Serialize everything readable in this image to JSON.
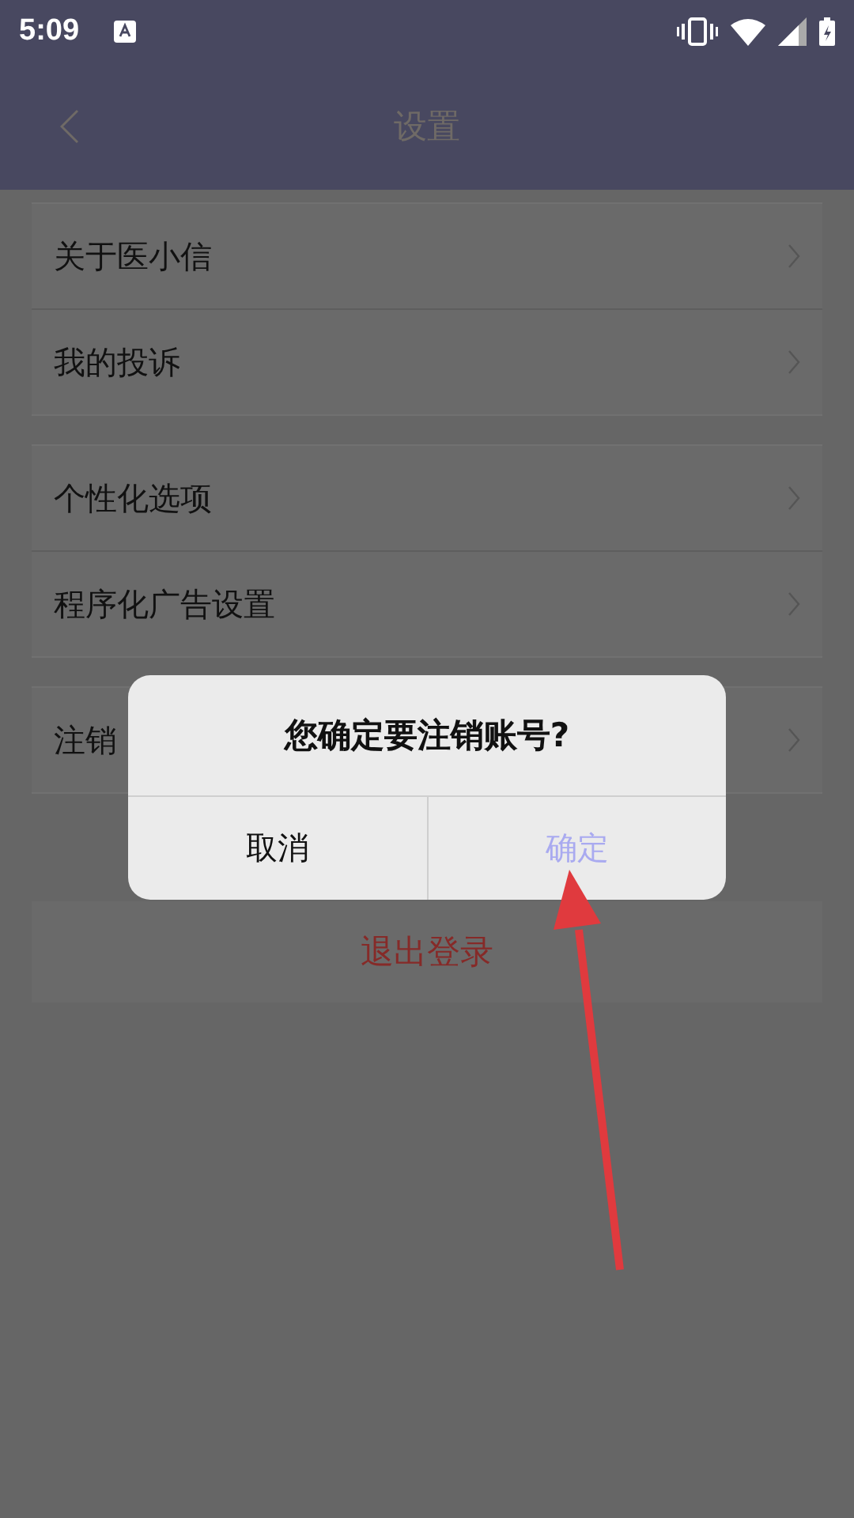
{
  "status_bar": {
    "time": "5:09"
  },
  "header": {
    "title": "设置"
  },
  "groups": [
    {
      "items": [
        {
          "label": "关于医小信"
        },
        {
          "label": "我的投诉"
        }
      ]
    },
    {
      "items": [
        {
          "label": "个性化选项"
        },
        {
          "label": "程序化广告设置"
        }
      ]
    },
    {
      "items": [
        {
          "label": "注销"
        }
      ]
    }
  ],
  "logout": {
    "label": "退出登录"
  },
  "dialog": {
    "title": "您确定要注销账号?",
    "buttons": [
      {
        "label": "取消",
        "kind": "cancel"
      },
      {
        "label": "确定",
        "kind": "confirm"
      }
    ]
  }
}
